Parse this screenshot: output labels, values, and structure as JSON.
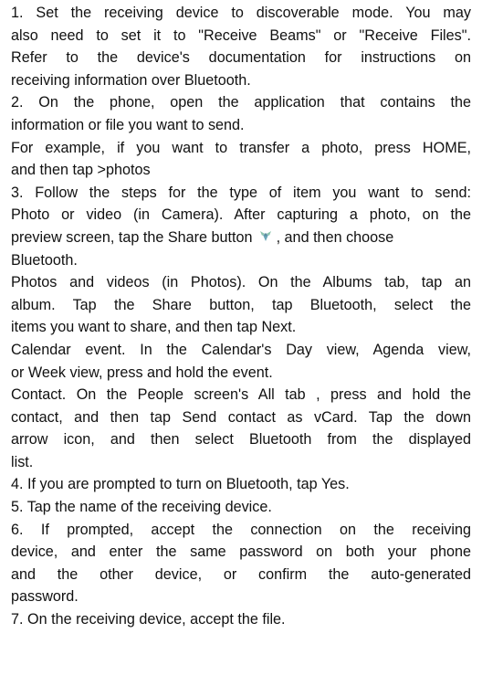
{
  "lines": [
    "1.  Set the receiving device to discoverable mode. You may",
    "also need to set it to \"Receive Beams\" or \"Receive Files\".",
    "Refer to the device's documentation for instructions on",
    "receiving information over Bluetooth.",
    "2.  On the phone, open the application that contains the",
    "information or file you want to send.",
    "For example, if you want to transfer a photo, press HOME,",
    "and then tap >photos",
    "3.  Follow the steps for the type of item you want to send:",
    "Photo or video (in Camera). After capturing a photo, on the",
    "preview screen, tap the Share button",
    ", and then choose",
    "Bluetooth.",
    "Photos and videos (in Photos). On the Albums tab, tap an",
    "album. Tap the Share button, tap Bluetooth, select the",
    "items you want to share, and then tap Next.",
    "Calendar event. In the Calendar's Day view, Agenda view,",
    "or Week view, press and hold the event.",
    "Contact. On the People screen's All tab , press and hold the",
    "contact, and then tap Send contact as vCard. Tap the down",
    "arrow icon, and then select Bluetooth from the displayed",
    "list.",
    "4.  If you are prompted to turn on Bluetooth, tap Yes.",
    "5.  Tap the name of the receiving device.",
    "6.   If prompted, accept the connection on the receiving",
    "device, and enter the same password on both your phone",
    "and the other device, or confirm the auto-generated",
    "password.",
    "7.  On the receiving device, accept the file."
  ],
  "icons": {
    "share": "share-icon",
    "share_color": "#7fb6a3"
  }
}
